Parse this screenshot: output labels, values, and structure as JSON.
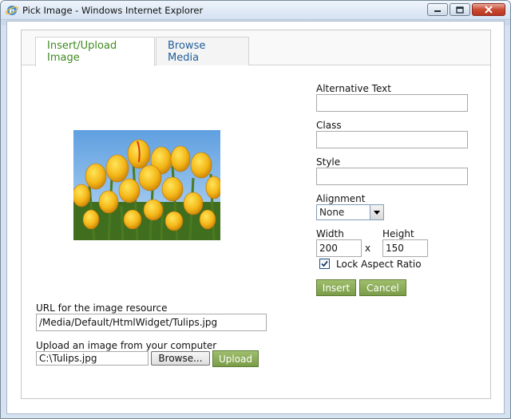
{
  "window": {
    "title": "Pick Image - Windows Internet Explorer",
    "icon": "ie-icon"
  },
  "tabs": [
    {
      "label": "Insert/Upload Image",
      "active": true
    },
    {
      "label": "Browse Media",
      "active": false
    }
  ],
  "form": {
    "alt_text_label": "Alternative Text",
    "alt_text_value": "",
    "class_label": "Class",
    "class_value": "",
    "style_label": "Style",
    "style_value": "",
    "alignment_label": "Alignment",
    "alignment_value": "None",
    "width_label": "Width",
    "width_value": "200",
    "dimension_separator": "x",
    "height_label": "Height",
    "height_value": "150",
    "lock_aspect_label": "Lock Aspect Ratio",
    "lock_aspect_checked": true,
    "insert_label": "Insert",
    "cancel_label": "Cancel"
  },
  "url": {
    "label": "URL for the image resource",
    "value": "/Media/Default/HtmlWidget/Tulips.jpg"
  },
  "upload": {
    "label": "Upload an image from your computer",
    "file_value": "C:\\Tulips.jpg",
    "browse_label": "Browse...",
    "upload_label": "Upload"
  },
  "preview": {
    "subject": "yellow tulips against blue sky"
  },
  "colors": {
    "accent_green": "#7a9c48",
    "active_tab_text": "#3e8a1e",
    "inactive_tab_text": "#1f5e99"
  }
}
